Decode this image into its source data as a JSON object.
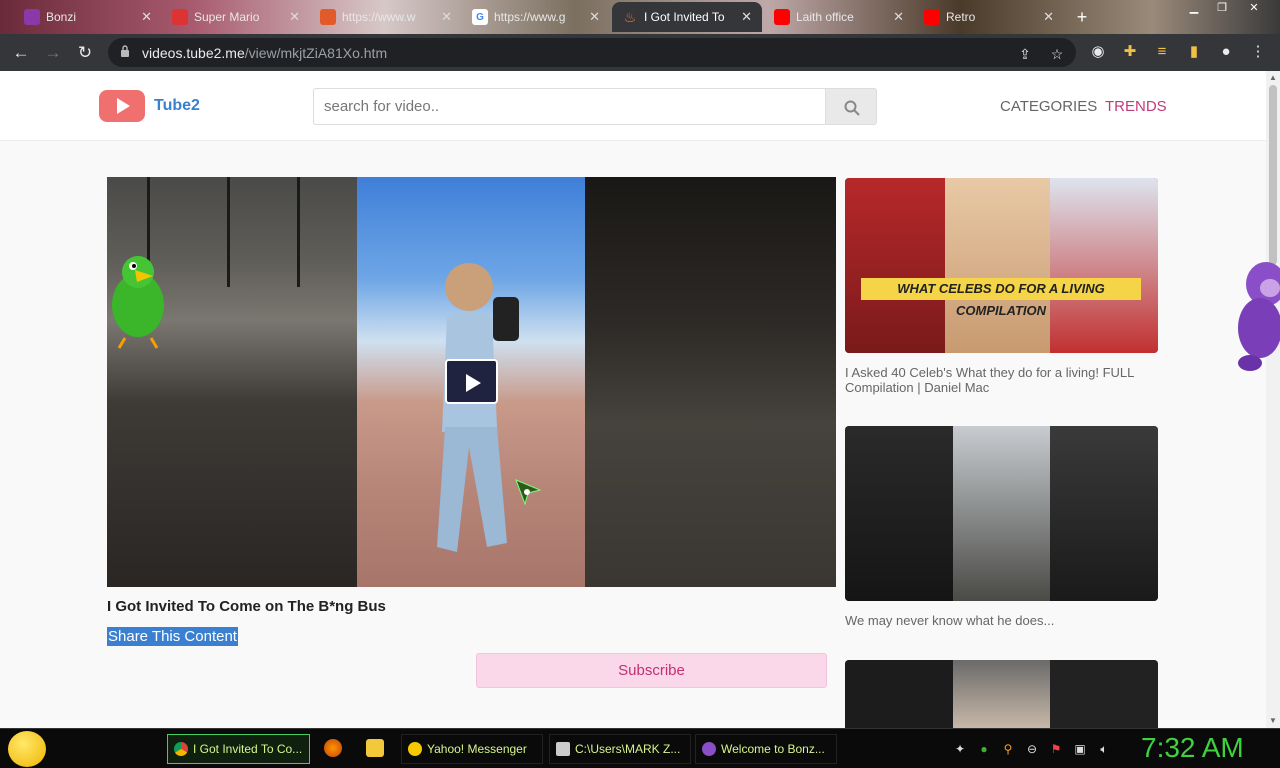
{
  "browser": {
    "tabs": [
      {
        "label": "Bonzi",
        "icon": "bonzi-icon"
      },
      {
        "label": "Super Mario",
        "icon": "mario-icon"
      },
      {
        "label": "https://www.w",
        "icon": "web-icon"
      },
      {
        "label": "https://www.g",
        "icon": "google-icon"
      },
      {
        "label": "I Got Invited To",
        "icon": "flame-icon",
        "active": true
      },
      {
        "label": "Laith office",
        "icon": "youtube-icon"
      },
      {
        "label": "Retro",
        "icon": "youtube-icon"
      }
    ],
    "url_domain": "videos.tube2.me",
    "url_path": "/view/mkjtZiA81Xo.htm"
  },
  "site": {
    "logo_text": "Tube2",
    "search_placeholder": "search for video..",
    "nav": {
      "categories": "CATEGORIES",
      "trends": "TRENDS"
    },
    "accent_color": "#c23a7a"
  },
  "video": {
    "title": "I Got Invited To Come on The B*ng Bus",
    "share_label": "Share This Content",
    "subscribe_label": "Subscribe"
  },
  "sidebar": {
    "items": [
      {
        "caption": "WHAT CELEBS DO FOR A LIVING COMPILATION",
        "title": "I Asked 40 Celeb's What they do for a living! FULL Compilation | Daniel Mac"
      },
      {
        "caption": "",
        "title": "We may never know what he does..."
      },
      {
        "caption": "",
        "title": ""
      }
    ]
  },
  "taskbar": {
    "tasks": [
      {
        "label": "I Got Invited To Co...",
        "icon": "chrome-icon",
        "active": true
      },
      {
        "label": "Yahoo! Messenger",
        "icon": "yahoo-icon"
      },
      {
        "label": "C:\\Users\\MARK Z...",
        "icon": "cmd-icon"
      },
      {
        "label": "Welcome to Bonz...",
        "icon": "bonzi-icon"
      }
    ],
    "clock": "7:32 AM"
  }
}
